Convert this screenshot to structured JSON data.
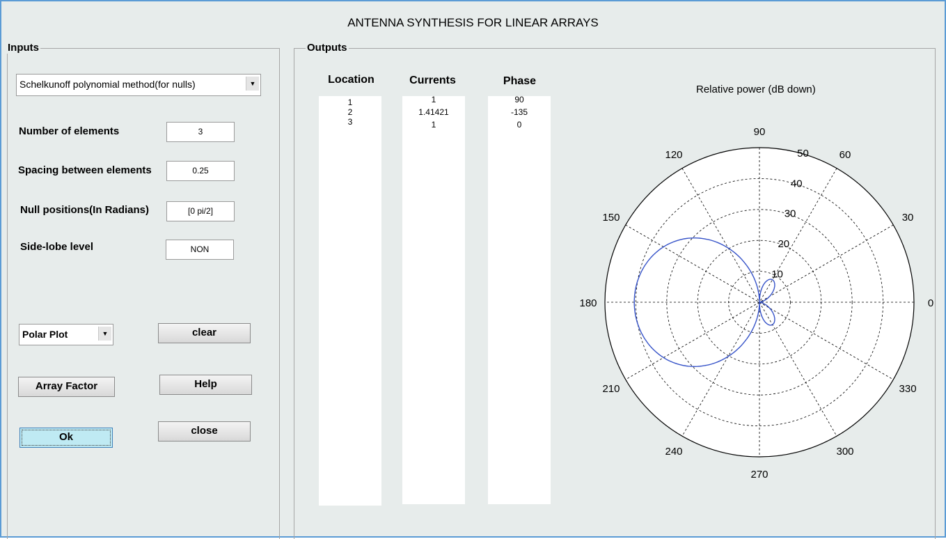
{
  "window": {
    "title": "ANTENNA SYNTHESIS FOR LINEAR ARRAYS"
  },
  "inputs": {
    "panel_label": "Inputs",
    "method_select": "Schelkunoff polynomial method(for nulls)",
    "num_elements_label": "Number of elements",
    "num_elements_value": "3",
    "spacing_label": "Spacing between elements",
    "spacing_value": "0.25",
    "null_label": "Null positions(In Radians)",
    "null_value": "[0 pi/2]",
    "sidelobe_label": "Side-lobe level",
    "sidelobe_value": "NON",
    "plot_select": "Polar Plot",
    "clear_label": "clear",
    "array_factor_label": "Array Factor",
    "help_label": "Help",
    "ok_label": "Ok",
    "close_label": "close"
  },
  "outputs": {
    "panel_label": "Outputs",
    "location_header": "Location",
    "currents_header": "Currents",
    "phase_header": "Phase",
    "locations": [
      "1",
      "2",
      "3"
    ],
    "currents": [
      "1",
      "1.41421",
      "1"
    ],
    "phases": [
      "90",
      "-135",
      "0"
    ]
  },
  "chart_data": {
    "type": "polar",
    "title": "Relative power (dB down)",
    "angle_ticks": [
      "0",
      "30",
      "60",
      "90",
      "120",
      "150",
      "180",
      "210",
      "240",
      "270",
      "300",
      "330"
    ],
    "radial_ticks": [
      "10",
      "20",
      "30",
      "40",
      "50"
    ],
    "rlim": [
      0,
      50
    ],
    "series_color": "#3552c8",
    "pattern_description": "|AF(theta)| for 3-element Schelkunoff array, nulls at 0 and pi/2",
    "nulls_deg": [
      0,
      90,
      270
    ]
  }
}
